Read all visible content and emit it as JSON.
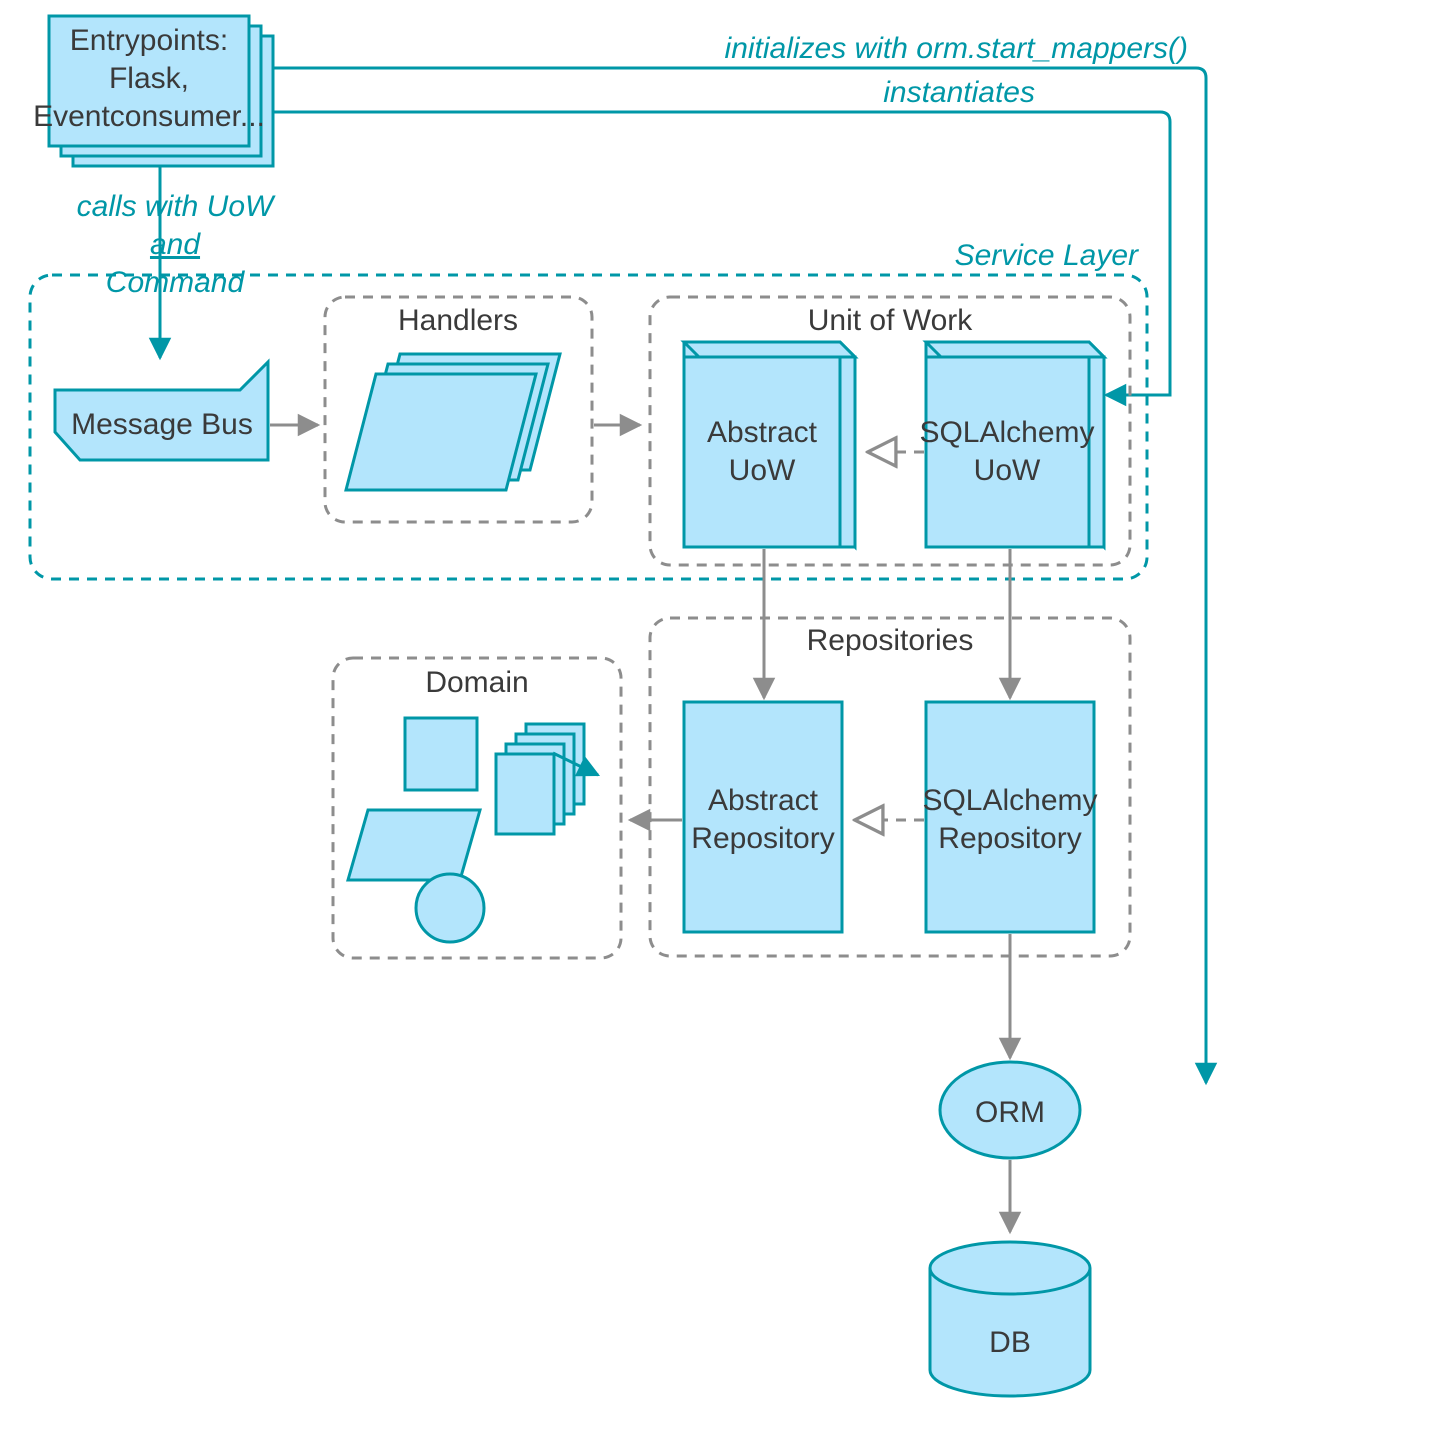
{
  "entrypoints": {
    "line1": "Entrypoints:",
    "line2": "Flask,",
    "line3": "Eventconsumer..."
  },
  "edges": {
    "init": "initializes with orm.start_mappers()",
    "instantiates": "instantiates",
    "calls1": "calls with UoW",
    "calls2": "and",
    "calls3": "Command"
  },
  "service_layer": {
    "title": "Service Layer"
  },
  "message_bus": "Message Bus",
  "handlers": {
    "title": "Handlers"
  },
  "uow": {
    "title": "Unit of Work",
    "abstract": {
      "l1": "Abstract",
      "l2": "UoW"
    },
    "sql": {
      "l1": "SQLAlchemy",
      "l2": "UoW"
    }
  },
  "repositories": {
    "title": "Repositories",
    "abstract": {
      "l1": "Abstract",
      "l2": "Repository"
    },
    "sql": {
      "l1": "SQLAlchemy",
      "l2": "Repository"
    }
  },
  "domain": {
    "title": "Domain"
  },
  "orm": "ORM",
  "db": "DB"
}
